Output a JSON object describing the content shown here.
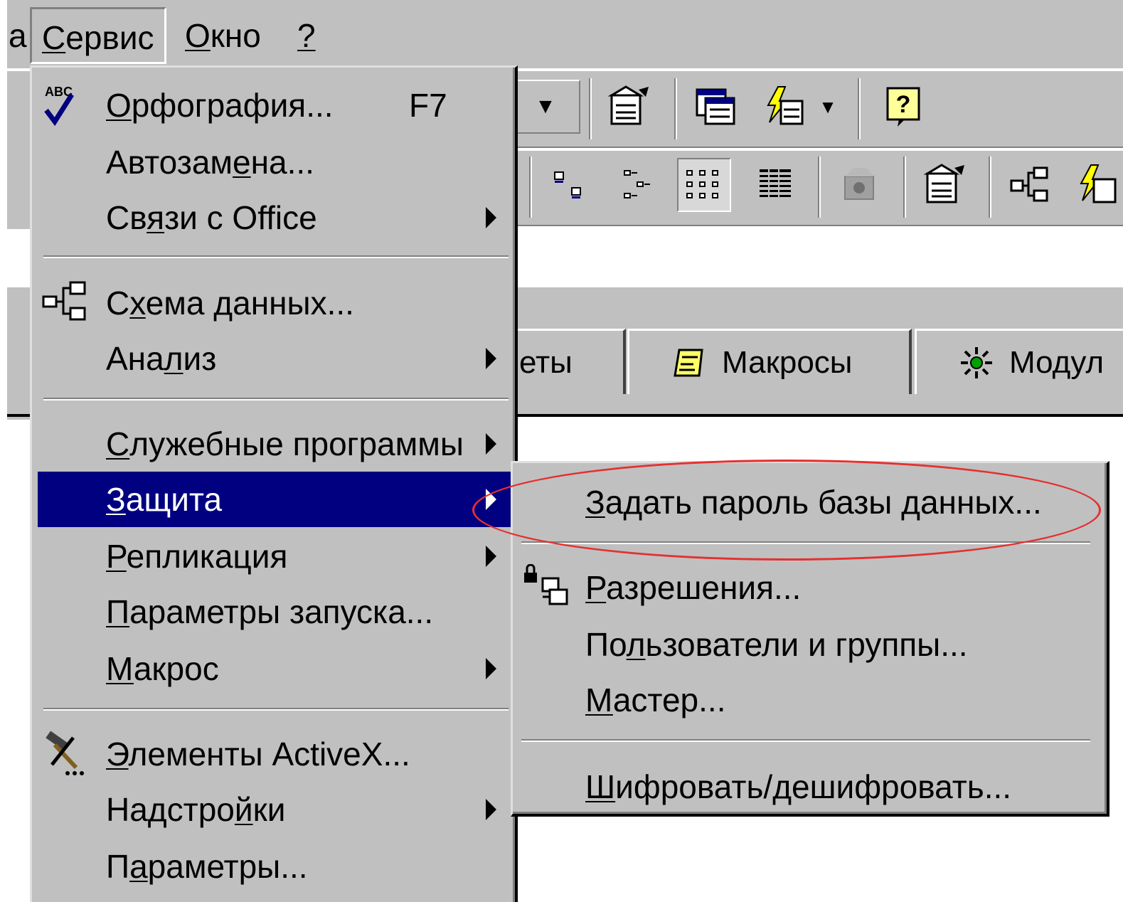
{
  "menubar": {
    "partial_label": "a",
    "items": [
      {
        "pre": "",
        "u": "С",
        "post": "ервис"
      },
      {
        "pre": "",
        "u": "О",
        "post": "кно"
      },
      {
        "pre": "",
        "u": "?",
        "post": ""
      }
    ]
  },
  "tabs": {
    "partial_label": "еты",
    "macros_label": "Макросы",
    "modules_label": "Модул"
  },
  "servis_menu": {
    "spelling": {
      "pre": "",
      "u": "О",
      "post": "рфография...",
      "shortcut": "F7"
    },
    "autocorrect": {
      "pre": "Автозам",
      "u": "е",
      "post": "на..."
    },
    "office_links": {
      "pre": "Св",
      "u": "я",
      "post": "зи с Office"
    },
    "relationships": {
      "pre": "С",
      "u": "х",
      "post": "ема данных..."
    },
    "analyze": {
      "pre": "Ана",
      "u": "л",
      "post": "из"
    },
    "utilities": {
      "pre": "",
      "u": "С",
      "post": "лужебные программы"
    },
    "security": {
      "pre": "",
      "u": "З",
      "post": "ащита"
    },
    "replication": {
      "pre": "",
      "u": "Р",
      "post": "епликация"
    },
    "startup": {
      "pre": "",
      "u": "П",
      "post": "араметры запуска..."
    },
    "macro": {
      "pre": "",
      "u": "М",
      "post": "акрос"
    },
    "activex": {
      "pre": "",
      "u": "Э",
      "post": "лементы ActiveX..."
    },
    "addins": {
      "pre": "Надстро",
      "u": "й",
      "post": "ки"
    },
    "options": {
      "pre": "П",
      "u": "а",
      "post": "раметры..."
    }
  },
  "security_submenu": {
    "set_password": {
      "pre": "",
      "u": "З",
      "post": "адать пароль базы данных..."
    },
    "permissions": {
      "pre": "",
      "u": "Р",
      "post": "азрешения..."
    },
    "users_groups": {
      "pre": "По",
      "u": "л",
      "post": "ьзователи и группы..."
    },
    "wizard": {
      "pre": "",
      "u": "М",
      "post": "астер..."
    },
    "encrypt": {
      "pre": "",
      "u": "Ш",
      "post": "ифровать/дешифровать..."
    }
  },
  "colors": {
    "menu_bg": "#c0c0c0",
    "highlight": "#000080",
    "oval": "#e53030"
  }
}
